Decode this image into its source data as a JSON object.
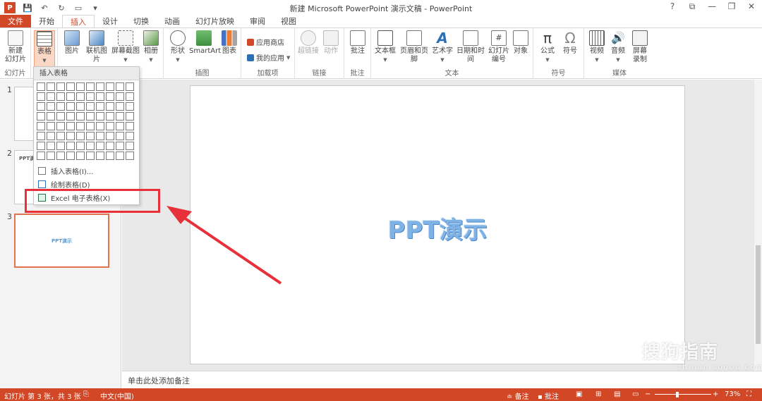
{
  "window": {
    "title": "新建 Microsoft PowerPoint 演示文稿 - PowerPoint",
    "qat_icons": [
      "powerpoint-logo",
      "save-icon",
      "undo-icon",
      "redo-icon",
      "start-from-beginning-icon",
      "customize-qat-icon"
    ],
    "controls": {
      "help": "?",
      "ribbon_display": "⧉",
      "minimize": "—",
      "restore": "❐",
      "close": "✕"
    }
  },
  "tabs": [
    "文件",
    "开始",
    "插入",
    "设计",
    "切换",
    "动画",
    "幻灯片放映",
    "审阅",
    "视图"
  ],
  "active_tab": "插入",
  "ribbon": {
    "groups": {
      "slides": "幻灯片",
      "images": "插图",
      "addins": "加载项",
      "links": "链接",
      "comments": "批注",
      "text": "文本",
      "symbols": "符号",
      "media": "媒体"
    },
    "buttons": {
      "new_slide": "新建\n幻灯片",
      "table": "表格",
      "picture": "图片",
      "online_picture": "联机图片",
      "screenshot": "屏幕截图",
      "album": "相册",
      "shapes": "形状",
      "smartart": "SmartArt",
      "chart": "图表",
      "store": "应用商店",
      "my_apps": "我的应用",
      "hyperlink": "超链接",
      "action": "动作",
      "comment": "批注",
      "textbox": "文本框",
      "header_footer": "页眉和页脚",
      "wordart": "艺术字",
      "datetime": "日期和时间",
      "slide_number": "幻灯片\n编号",
      "object": "对象",
      "equation": "公式",
      "symbol": "符号",
      "video": "视频",
      "audio": "音频",
      "screen_recording": "屏幕\n录制"
    }
  },
  "slides": [
    {
      "number": "1",
      "text": ""
    },
    {
      "number": "2",
      "text": "PPT演示"
    },
    {
      "number": "3",
      "text": "PPT演示"
    }
  ],
  "main_slide": {
    "title": "PPT演示"
  },
  "notes_placeholder": "单击此处添加备注",
  "table_menu": {
    "header": "插入表格",
    "grid": {
      "columns": 10,
      "rows": 8
    },
    "items": [
      {
        "label": "插入表格(I)...",
        "icon": "insert-table-icon"
      },
      {
        "label": "绘制表格(D)",
        "icon": "draw-table-icon"
      },
      {
        "label": "Excel 电子表格(X)",
        "icon": "excel-spreadsheet-icon"
      }
    ]
  },
  "status": {
    "slide_info": "幻灯片 第 3 张，共 3 张",
    "language": "中文(中国)",
    "notes": "备注",
    "comments": "批注",
    "zoom": "73%"
  },
  "watermark": {
    "main": "搜狗指南",
    "url": "zhinan.sogou.com"
  },
  "colors": {
    "accent": "#d24726",
    "highlight": "#e8303a",
    "slide_text": "#7fb2e5"
  }
}
